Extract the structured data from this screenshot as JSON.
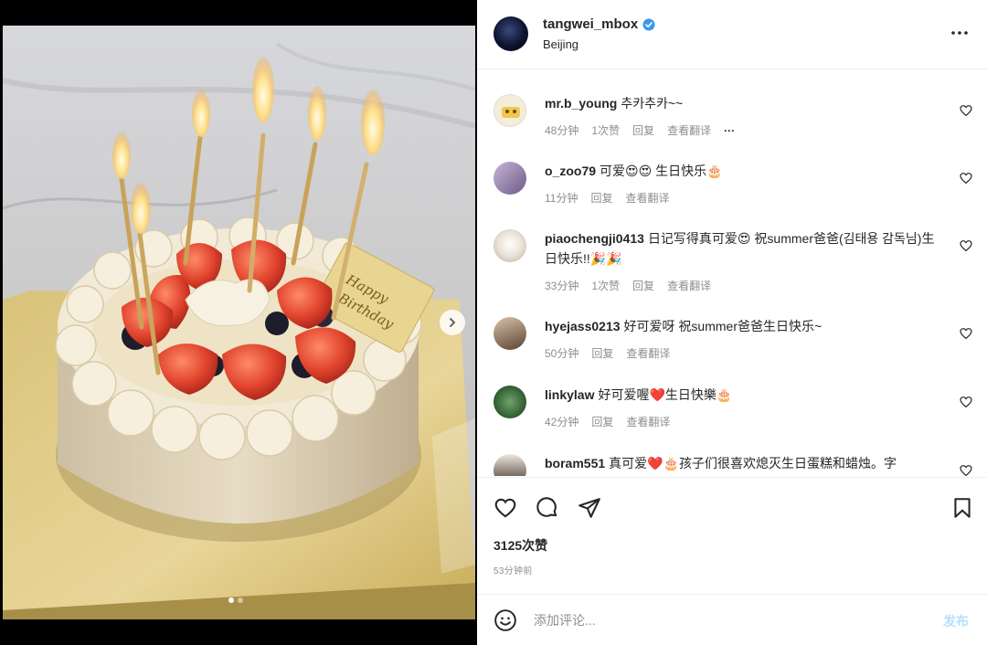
{
  "post": {
    "owner": "tangwei_mbox",
    "location": "Beijing",
    "likes": "3125次赞",
    "time_ago": "53分钟前"
  },
  "comments": [
    {
      "user": "mr.b_young",
      "text": "추카추카~~",
      "time": "48分钟",
      "likes": "1次赞",
      "reply": "回复",
      "translate": "查看翻译",
      "more": "···"
    },
    {
      "user": "o_zoo79",
      "text": "可爱😍😍 生日快乐🎂",
      "time": "11分钟",
      "reply": "回复",
      "translate": "查看翻译"
    },
    {
      "user": "piaochengji0413",
      "text": "日记写得真可爱😍 祝summer爸爸(김태용 감독님)生日快乐!!🎉🎉",
      "time": "33分钟",
      "likes": "1次赞",
      "reply": "回复",
      "translate": "查看翻译"
    },
    {
      "user": "hyejass0213",
      "text": "好可爱呀 祝summer爸爸生日快乐~",
      "time": "50分钟",
      "reply": "回复",
      "translate": "查看翻译"
    },
    {
      "user": "linkylaw",
      "text": "好可爱喔❤️生日快樂🎂",
      "time": "42分钟",
      "reply": "回复",
      "translate": "查看翻译"
    },
    {
      "user": "boram551",
      "text": "真可爱❤️🎂孩子们很喜欢熄灭生日蛋糕和蜡烛。字"
    }
  ],
  "composer": {
    "placeholder": "添加评论...",
    "post_label": "发布"
  },
  "icons": {
    "verified": "verified-badge-icon",
    "more": "more-options-icon",
    "like": "heart-icon",
    "comment": "comment-icon",
    "share": "share-icon",
    "save": "bookmark-icon",
    "emoji": "emoji-icon",
    "next": "chevron-right-icon"
  },
  "colors": {
    "verified_blue": "#3897f0",
    "muted_text": "#8e8e8e",
    "post_button": "#b2dffc"
  }
}
